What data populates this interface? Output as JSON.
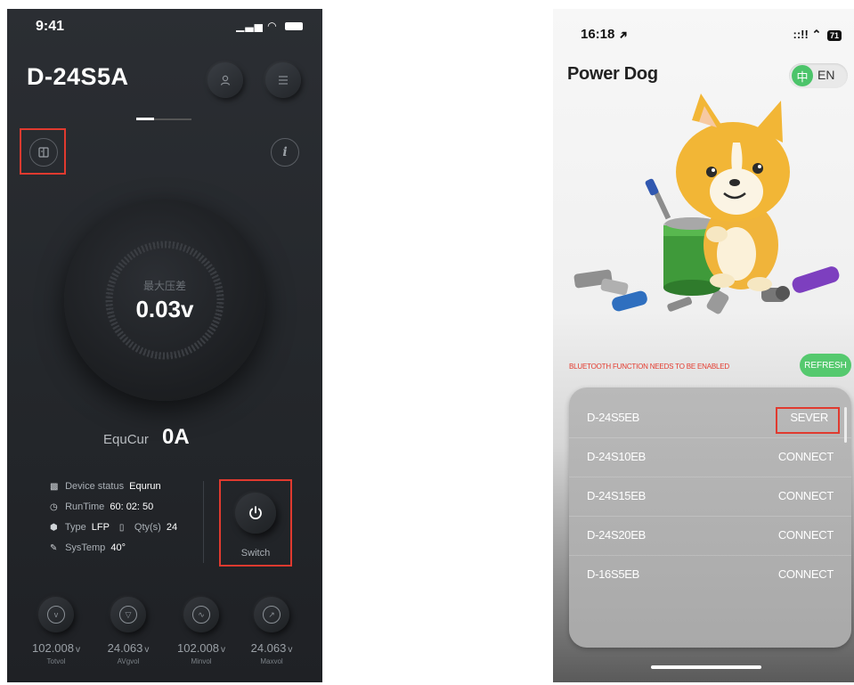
{
  "left_app": {
    "status_bar": {
      "time": "9:41",
      "signal": "▁▃▅",
      "wifi": "◠"
    },
    "device_title": "D-24S5A",
    "header_icons": {
      "profile": "person-icon",
      "menu": "menu-icon"
    },
    "book_icon": "book-icon",
    "info_icon_glyph": "i",
    "gauge": {
      "label": "最大压差",
      "value": "0.03v"
    },
    "equ": {
      "label": "EquCur",
      "value": "0A"
    },
    "status": {
      "device_status_label": "Device status",
      "device_status_value": "Equrun",
      "runtime_label": "RunTime",
      "runtime_value": "60: 02: 50",
      "type_label": "Type",
      "type_value": "LFP",
      "qty_label": "Qty(s)",
      "qty_value": "24",
      "systemp_label": "SysTemp",
      "systemp_value": "40°"
    },
    "switch_label": "Switch",
    "metrics": [
      {
        "value": "102.008",
        "unit": "v",
        "name": "Totvol",
        "icon": "v-circle-icon"
      },
      {
        "value": "24.063",
        "unit": "v",
        "name": "AVgvol",
        "icon": "triangle-down-icon"
      },
      {
        "value": "102.008",
        "unit": "v",
        "name": "Minvol",
        "icon": "wave-icon"
      },
      {
        "value": "24.063",
        "unit": "v",
        "name": "Maxvol",
        "icon": "trend-up-icon"
      }
    ],
    "colors": {
      "background": "#2b2e33",
      "highlight_box": "#e03a2f"
    }
  },
  "right_app": {
    "status_bar": {
      "time": "16:18",
      "location_glyph": "➔",
      "signal": "::!!",
      "battery": "71"
    },
    "brand": "Power Dog",
    "language": {
      "zh": "中",
      "en": "EN"
    },
    "bluetooth_warning": "BLUETOOTH FUNCTION NEEDS TO BE ENABLED",
    "refresh_label": "REFRESH",
    "devices": [
      {
        "name": "D-24S5EB",
        "action": "SEVER"
      },
      {
        "name": "D-24S10EB",
        "action": "CONNECT"
      },
      {
        "name": "D-24S15EB",
        "action": "CONNECT"
      },
      {
        "name": "D-24S20EB",
        "action": "CONNECT"
      },
      {
        "name": "D-16S5EB",
        "action": "CONNECT"
      }
    ],
    "colors": {
      "accent_green": "#55c96e",
      "warning_red": "#e43b2f",
      "highlight_box": "#e03a2f"
    }
  }
}
